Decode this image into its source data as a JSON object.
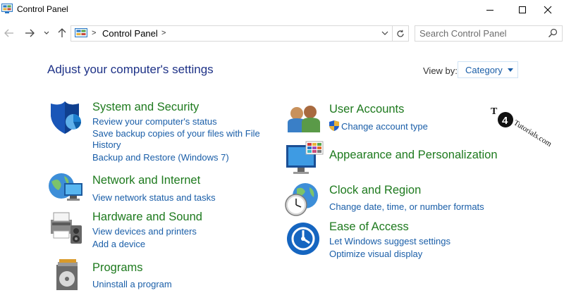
{
  "window": {
    "title": "Control Panel"
  },
  "address": {
    "crumb": "Control Panel",
    "separator": ">"
  },
  "search": {
    "placeholder": "Search Control Panel"
  },
  "header": {
    "title": "Adjust your computer's settings",
    "view_by_label": "View by:",
    "view_by_value": "Category"
  },
  "categories": {
    "system": {
      "title": "System and Security",
      "links": [
        "Review your computer's status",
        "Save backup copies of your files with File",
        "History",
        "Backup and Restore (Windows 7)"
      ]
    },
    "network": {
      "title": "Network and Internet",
      "links": [
        "View network status and tasks"
      ]
    },
    "hardware": {
      "title": "Hardware and Sound",
      "links": [
        "View devices and printers",
        "Add a device"
      ]
    },
    "programs": {
      "title": "Programs",
      "links": [
        "Uninstall a program"
      ]
    },
    "users": {
      "title": "User Accounts",
      "links": [
        "Change account type"
      ]
    },
    "appearance": {
      "title": "Appearance and Personalization"
    },
    "clock": {
      "title": "Clock and Region",
      "links": [
        "Change date, time, or number formats"
      ]
    },
    "ease": {
      "title": "Ease of Access",
      "links": [
        "Let Windows suggest settings",
        "Optimize visual display"
      ]
    }
  },
  "watermark": {
    "t": "T",
    "digit": "4",
    "text": "Tutorials.com"
  },
  "colors": {
    "category_title": "#1e7a1e",
    "link": "#1a5ea8",
    "page_title": "#1e3287"
  }
}
